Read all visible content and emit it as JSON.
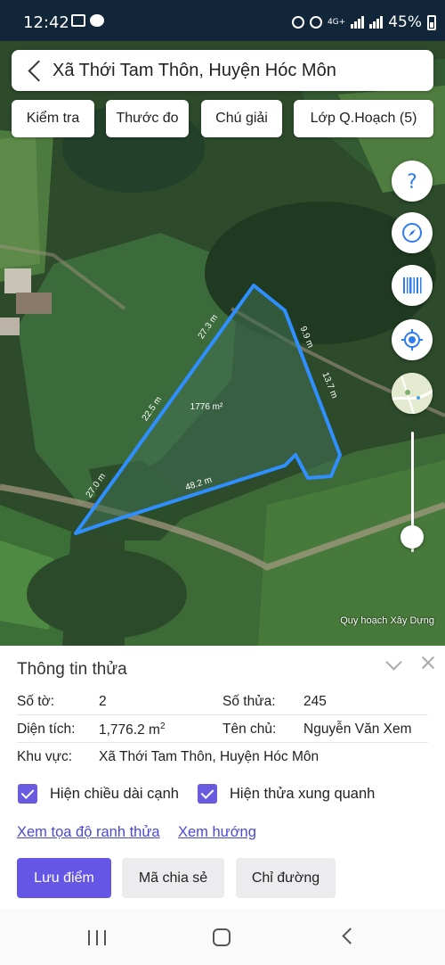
{
  "status_bar": {
    "time": "12:42",
    "network": "4G+",
    "battery": "45%"
  },
  "header": {
    "title": "Xã Thới Tam Thôn, Huyện Hóc Môn"
  },
  "toolbar": {
    "check": "Kiểm tra",
    "ruler": "Thước đo",
    "legend": "Chú giải",
    "layers": "Lớp Q.Hoạch (5)"
  },
  "map": {
    "area_label": "1776 m²",
    "edges": [
      "27.3 m",
      "9.9 m",
      "13.7 m",
      "48.2 m",
      "27.0 m",
      "22.5 m"
    ],
    "attribution": "Quy hoạch Xây Dựng",
    "zoom_level": 0.22
  },
  "panel": {
    "title": "Thông tin thửa",
    "so_to_label": "Số tờ:",
    "so_to_value": "2",
    "so_thua_label": "Số thửa:",
    "so_thua_value": "245",
    "dien_tich_label": "Diện tích:",
    "dien_tich_value": "1,776.2 m",
    "dien_tich_unit": "2",
    "ten_chu_label": "Tên chủ:",
    "ten_chu_value": "Nguyễn Văn Xem",
    "khu_vuc_label": "Khu vực:",
    "khu_vuc_value": "Xã Thới Tam Thôn, Huyện Hóc Môn",
    "check_edges": "Hiện chiều dài cạnh",
    "check_neighbors": "Hiện thửa xung quanh",
    "link_coords": "Xem tọa độ ranh thửa",
    "link_direction": "Xem hướng",
    "btn_save": "Lưu điểm",
    "btn_share": "Mã chia sẻ",
    "btn_directions": "Chỉ đường"
  },
  "colors": {
    "accent": "#6656e6",
    "boundary": "#2f8fff",
    "link": "#4a4ad0"
  }
}
